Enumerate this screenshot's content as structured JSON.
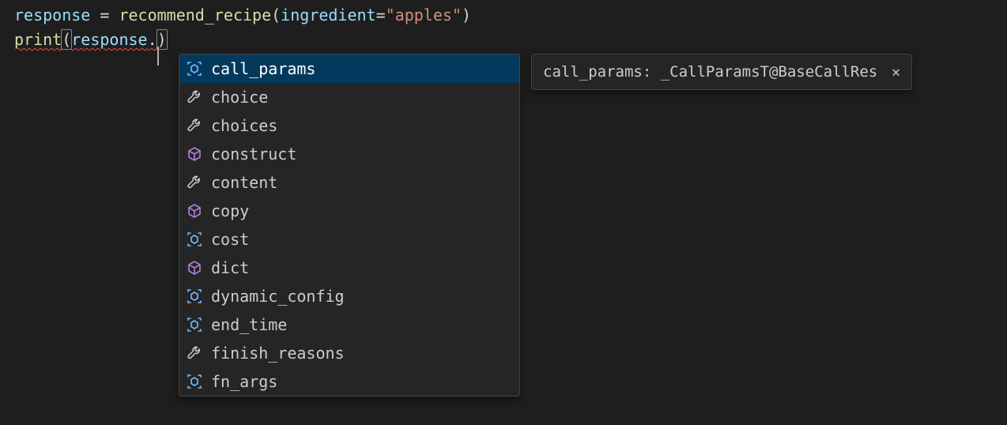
{
  "code": {
    "line1": {
      "var": "response",
      "eq": " = ",
      "func": "recommend_recipe",
      "open": "(",
      "param": "ingredient",
      "assign": "=",
      "str": "\"apples\"",
      "close": ")"
    },
    "line2": {
      "func": "print",
      "open": "(",
      "var": "response",
      "dot": ".",
      "close": ")"
    }
  },
  "suggestions": [
    {
      "label": "call_params",
      "icon": "field",
      "selected": true
    },
    {
      "label": "choice",
      "icon": "wrench",
      "selected": false
    },
    {
      "label": "choices",
      "icon": "wrench",
      "selected": false
    },
    {
      "label": "construct",
      "icon": "cube",
      "selected": false
    },
    {
      "label": "content",
      "icon": "wrench",
      "selected": false
    },
    {
      "label": "copy",
      "icon": "cube",
      "selected": false
    },
    {
      "label": "cost",
      "icon": "field",
      "selected": false
    },
    {
      "label": "dict",
      "icon": "cube",
      "selected": false
    },
    {
      "label": "dynamic_config",
      "icon": "field",
      "selected": false
    },
    {
      "label": "end_time",
      "icon": "field",
      "selected": false
    },
    {
      "label": "finish_reasons",
      "icon": "wrench",
      "selected": false
    },
    {
      "label": "fn_args",
      "icon": "field",
      "selected": false
    }
  ],
  "doc": {
    "text": "call_params: _CallParamsT@BaseCallRes",
    "close": "✕"
  }
}
